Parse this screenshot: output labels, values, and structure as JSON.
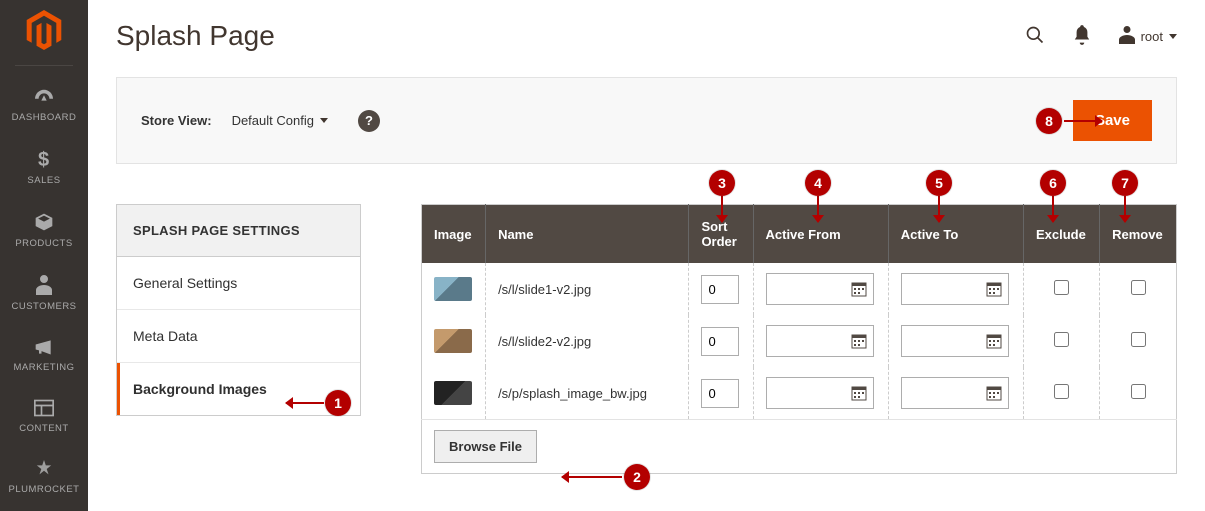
{
  "sidebar": {
    "items": [
      {
        "label": "DASHBOARD"
      },
      {
        "label": "SALES"
      },
      {
        "label": "PRODUCTS"
      },
      {
        "label": "CUSTOMERS"
      },
      {
        "label": "MARKETING"
      },
      {
        "label": "CONTENT"
      },
      {
        "label": "PLUMROCKET"
      }
    ]
  },
  "header": {
    "title": "Splash Page",
    "user": "root"
  },
  "toolbar": {
    "store_view_label": "Store View:",
    "store_view_value": "Default Config",
    "save_label": "Save"
  },
  "settings": {
    "panel_title": "SPLASH PAGE SETTINGS",
    "items": [
      {
        "label": "General Settings",
        "active": false
      },
      {
        "label": "Meta Data",
        "active": false
      },
      {
        "label": "Background Images",
        "active": true
      }
    ]
  },
  "table": {
    "headers": {
      "image": "Image",
      "name": "Name",
      "sort": "Sort Order",
      "from": "Active From",
      "to": "Active To",
      "exclude": "Exclude",
      "remove": "Remove"
    },
    "rows": [
      {
        "name": "/s/l/slide1-v2.jpg",
        "sort": "0",
        "from": "",
        "to": ""
      },
      {
        "name": "/s/l/slide2-v2.jpg",
        "sort": "0",
        "from": "",
        "to": ""
      },
      {
        "name": "/s/p/splash_image_bw.jpg",
        "sort": "0",
        "from": "",
        "to": ""
      }
    ],
    "browse_label": "Browse File"
  },
  "annotations": {
    "1": "1",
    "2": "2",
    "3": "3",
    "4": "4",
    "5": "5",
    "6": "6",
    "7": "7",
    "8": "8"
  }
}
